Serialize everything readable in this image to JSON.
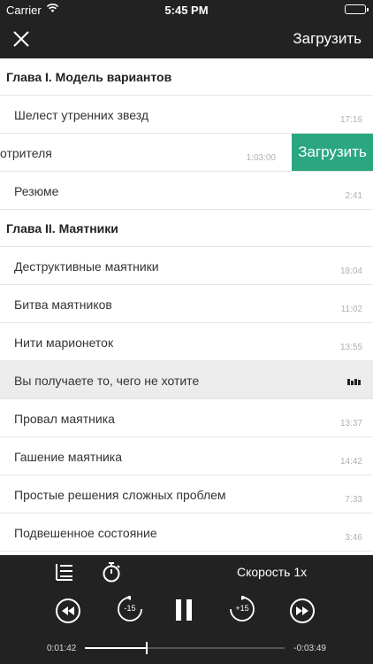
{
  "status_bar": {
    "carrier": "Carrier",
    "time": "5:45 PM"
  },
  "nav": {
    "close_icon": "close-icon",
    "upload_label": "Загрузить"
  },
  "sections": [
    {
      "title": "Глава I. Модель вариантов",
      "items": [
        {
          "title": "Шелест утренних звезд",
          "duration": "17:16"
        },
        {
          "title": "Смотрителя",
          "visible_title": "отрителя",
          "duration": "1:03:00",
          "swipe_action": "Загрузить"
        },
        {
          "title": "Резюме",
          "duration": "2:41"
        }
      ]
    },
    {
      "title": "Глава II. Маятники",
      "items": [
        {
          "title": "Деструктивные маятники",
          "duration": "18:04"
        },
        {
          "title": "Битва маятников",
          "duration": "11:02"
        },
        {
          "title": "Нити марионеток",
          "duration": "13:55"
        },
        {
          "title": "Вы получаете то, чего не хотите",
          "duration": "",
          "playing": true
        },
        {
          "title": "Провал маятника",
          "duration": "13:37"
        },
        {
          "title": "Гашение маятника",
          "duration": "14:42"
        },
        {
          "title": "Простые решения сложных проблем",
          "duration": "7:33"
        },
        {
          "title": "Подвешенное состояние",
          "duration": "3:46"
        }
      ]
    }
  ],
  "player": {
    "speed_label": "Скорость 1x",
    "rewind_label": "-15",
    "forward_label": "+15",
    "elapsed": "0:01:42",
    "remaining": "-0:03:49",
    "progress_fraction": 0.31,
    "icons": [
      "toc-icon",
      "timer-icon",
      "previous-icon",
      "rewind-15-icon",
      "pause-icon",
      "forward-15-icon",
      "next-icon"
    ]
  },
  "colors": {
    "bar_background": "#222222",
    "accent_green": "#2aa780",
    "active_row": "#ececec"
  }
}
